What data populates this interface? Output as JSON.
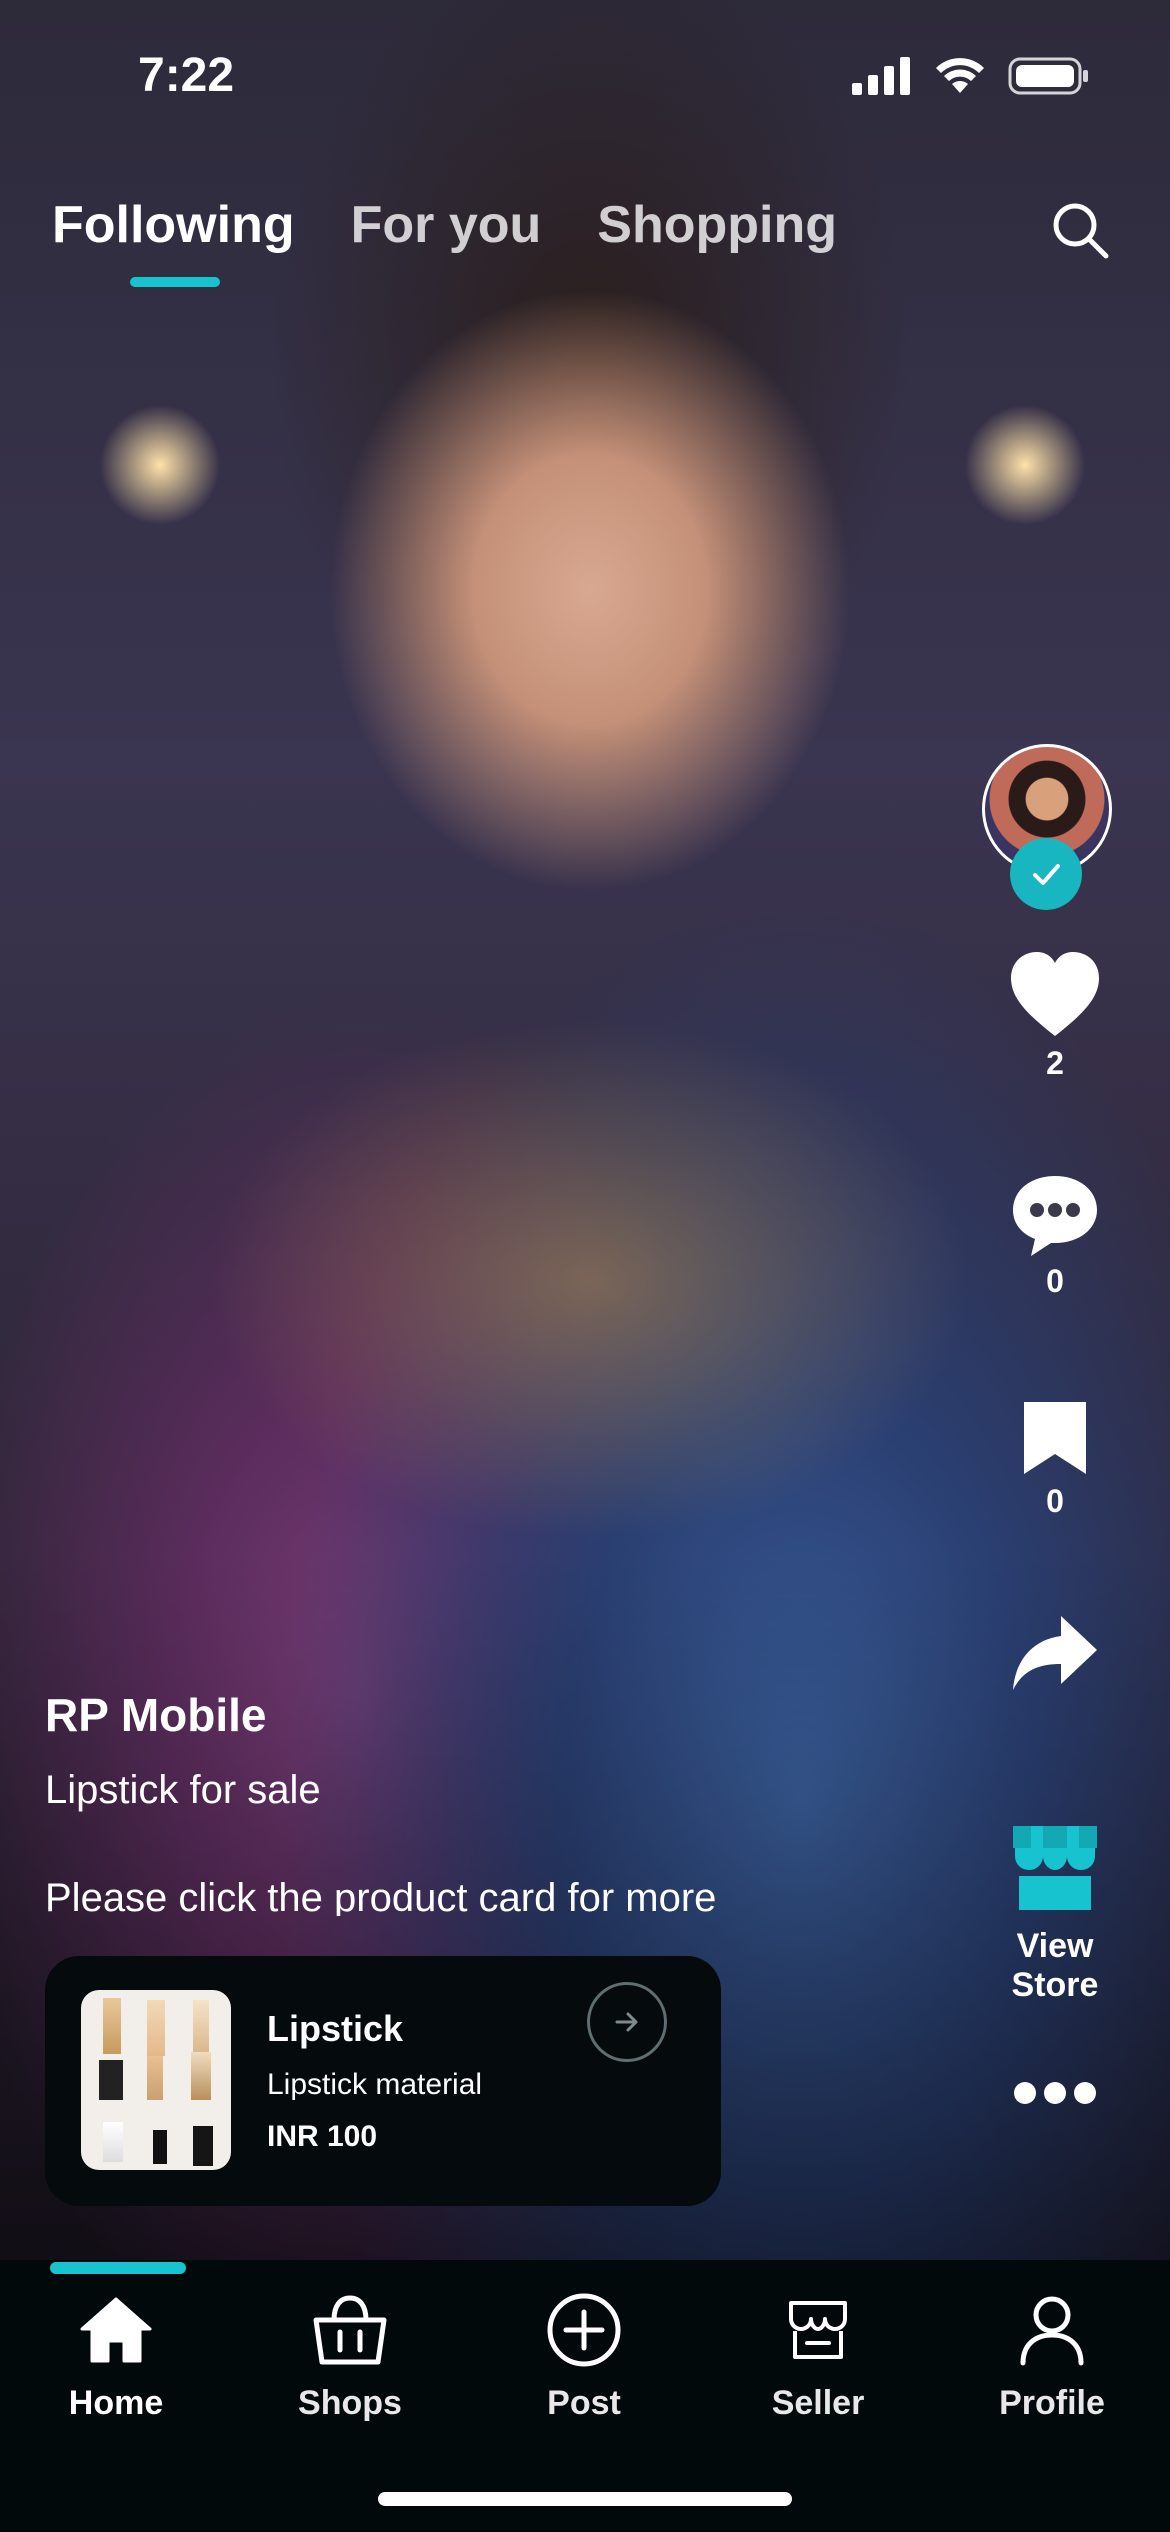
{
  "status_bar": {
    "time": "7:22"
  },
  "top_tabs": [
    {
      "label": "Following",
      "active": true
    },
    {
      "label": "For you",
      "active": false
    },
    {
      "label": "Shopping",
      "active": false
    }
  ],
  "icons": {
    "search": "search-icon",
    "like": "heart-icon",
    "comment": "comment-icon",
    "save": "bookmark-icon",
    "share": "share-icon",
    "store": "store-icon",
    "more": "more-icon"
  },
  "right_rail": {
    "likes": "2",
    "comments": "0",
    "saves": "0",
    "view_store": "View Store"
  },
  "post": {
    "author": "RP Mobile",
    "caption_line1": "Lipstick for sale",
    "caption_line2": "Please click the product card for more"
  },
  "product_card": {
    "title": "Lipstick",
    "subtitle": "Lipstick material",
    "price": "INR 100"
  },
  "bottom_nav": [
    {
      "label": "Home",
      "active": true
    },
    {
      "label": "Shops",
      "active": false
    },
    {
      "label": "Post",
      "active": false
    },
    {
      "label": "Seller",
      "active": false
    },
    {
      "label": "Profile",
      "active": false
    }
  ],
  "colors": {
    "accent": "#17c3cf",
    "card_bg": "#050b0d",
    "nav_bg": "#02090b"
  }
}
